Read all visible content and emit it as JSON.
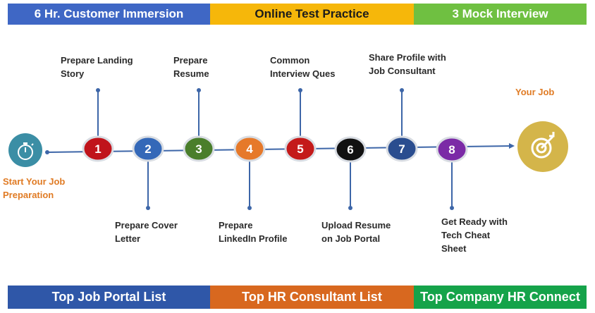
{
  "top_bands": [
    {
      "label": "6 Hr. Customer Immersion",
      "bg": "#3f67c5",
      "color": "#ffffff"
    },
    {
      "label": "Online Test Practice",
      "bg": "#f6b70a",
      "color": "#1b1b1b"
    },
    {
      "label": "3 Mock Interview",
      "bg": "#6fc041",
      "color": "#ffffff"
    }
  ],
  "bottom_bands": [
    {
      "label": "Top  Job Portal  List",
      "bg": "#2f57a8"
    },
    {
      "label": "Top HR Consultant List",
      "bg": "#d8681f"
    },
    {
      "label": "Top Company HR Connect",
      "bg": "#15a34a"
    }
  ],
  "start": {
    "label_line1": "Start Your Job",
    "label_line2": "Preparation",
    "icon": "stopwatch-icon",
    "color": "#3b8ea5"
  },
  "goal": {
    "label": "Your Job",
    "icon": "target-icon",
    "color": "#d4b54a"
  },
  "steps": [
    {
      "number": "1",
      "color": "#c0141b",
      "line1": "Prepare Landing",
      "line2": "Story"
    },
    {
      "number": "2",
      "color": "#3468b8",
      "line1": "Prepare Cover",
      "line2": "Letter"
    },
    {
      "number": "3",
      "color": "#4a7e2b",
      "line1": "Prepare",
      "line2": "Resume"
    },
    {
      "number": "4",
      "color": "#e6792a",
      "line1": "Prepare",
      "line2": "LinkedIn Profile"
    },
    {
      "number": "5",
      "color": "#c41a1a",
      "line1": "Common",
      "line2": "Interview Ques"
    },
    {
      "number": "6",
      "color": "#111111",
      "line1": "Upload Resume",
      "line2": "on Job Portal"
    },
    {
      "number": "7",
      "color": "#2a4d8f",
      "line1": "Share Profile with",
      "line2": "Job Consultant"
    },
    {
      "number": "8",
      "color": "#7b2aa6",
      "line1": "Get Ready with",
      "line2": "Tech Cheat",
      "line3": "Sheet"
    }
  ],
  "line_color": "#3d66a8"
}
